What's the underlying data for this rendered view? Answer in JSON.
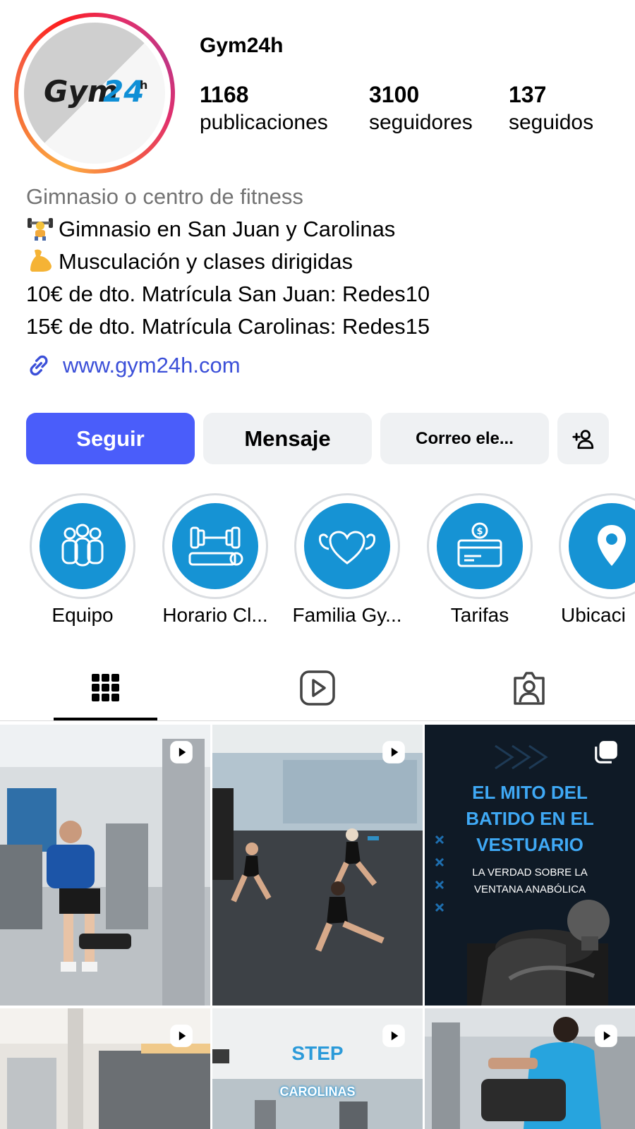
{
  "profile": {
    "username": "Gym24h",
    "avatar_text": "Gym24h",
    "stats": [
      {
        "value": "1168",
        "label": "publicaciones"
      },
      {
        "value": "3100",
        "label": "seguidores"
      },
      {
        "value": "137",
        "label": "seguidos"
      }
    ]
  },
  "bio": {
    "category": "Gimnasio o centro de fitness",
    "lines": [
      {
        "icon": "weightlifter-emoji",
        "text": "Gimnasio en San Juan y Carolinas"
      },
      {
        "icon": "flexed-biceps-emoji",
        "text": "Musculación y clases dirigidas"
      },
      {
        "icon": "",
        "text": "10€ de dto. Matrícula San Juan: Redes10"
      },
      {
        "icon": "",
        "text": "15€ de dto. Matrícula Carolinas: Redes15"
      }
    ],
    "link": "www.gym24h.com"
  },
  "actions": {
    "follow": "Seguir",
    "message": "Mensaje",
    "email": "Correo ele...",
    "add_person_icon": "add-person-icon"
  },
  "highlights": [
    {
      "label": "Equipo",
      "icon": "people-icon"
    },
    {
      "label": "Horario Cl...",
      "icon": "dumbbell-mat-icon"
    },
    {
      "label": "Familia Gy...",
      "icon": "heart-muscle-icon"
    },
    {
      "label": "Tarifas",
      "icon": "price-card-icon"
    },
    {
      "label": "Ubicaci",
      "icon": "location-pin-icon"
    }
  ],
  "tabs": [
    {
      "name": "grid",
      "icon": "grid-icon",
      "active": true
    },
    {
      "name": "reels",
      "icon": "reels-icon",
      "active": false
    },
    {
      "name": "tagged",
      "icon": "tagged-icon",
      "active": false
    }
  ],
  "posts": [
    {
      "kind": "reel",
      "badge": "reel-icon",
      "caption": ""
    },
    {
      "kind": "reel",
      "badge": "reel-icon",
      "caption": ""
    },
    {
      "kind": "carousel",
      "badge": "carousel-icon",
      "title_lines": [
        "EL MITO DEL",
        "BATIDO EN EL",
        "VESTUARIO"
      ],
      "subtitle_lines": [
        "LA VERDAD SOBRE LA",
        "VENTANA ANABÓLICA"
      ]
    },
    {
      "kind": "reel",
      "badge": "reel-icon",
      "caption": ""
    },
    {
      "kind": "reel",
      "badge": "reel-icon",
      "title_lines": [
        "STEP",
        "CAROLINAS"
      ]
    },
    {
      "kind": "reel",
      "badge": "reel-icon",
      "caption": ""
    }
  ],
  "colors": {
    "follow_button": "#4a5dfa",
    "link": "#3b4fd8",
    "highlight_disc": "#1693d4",
    "secondary_button": "#eff1f3"
  }
}
